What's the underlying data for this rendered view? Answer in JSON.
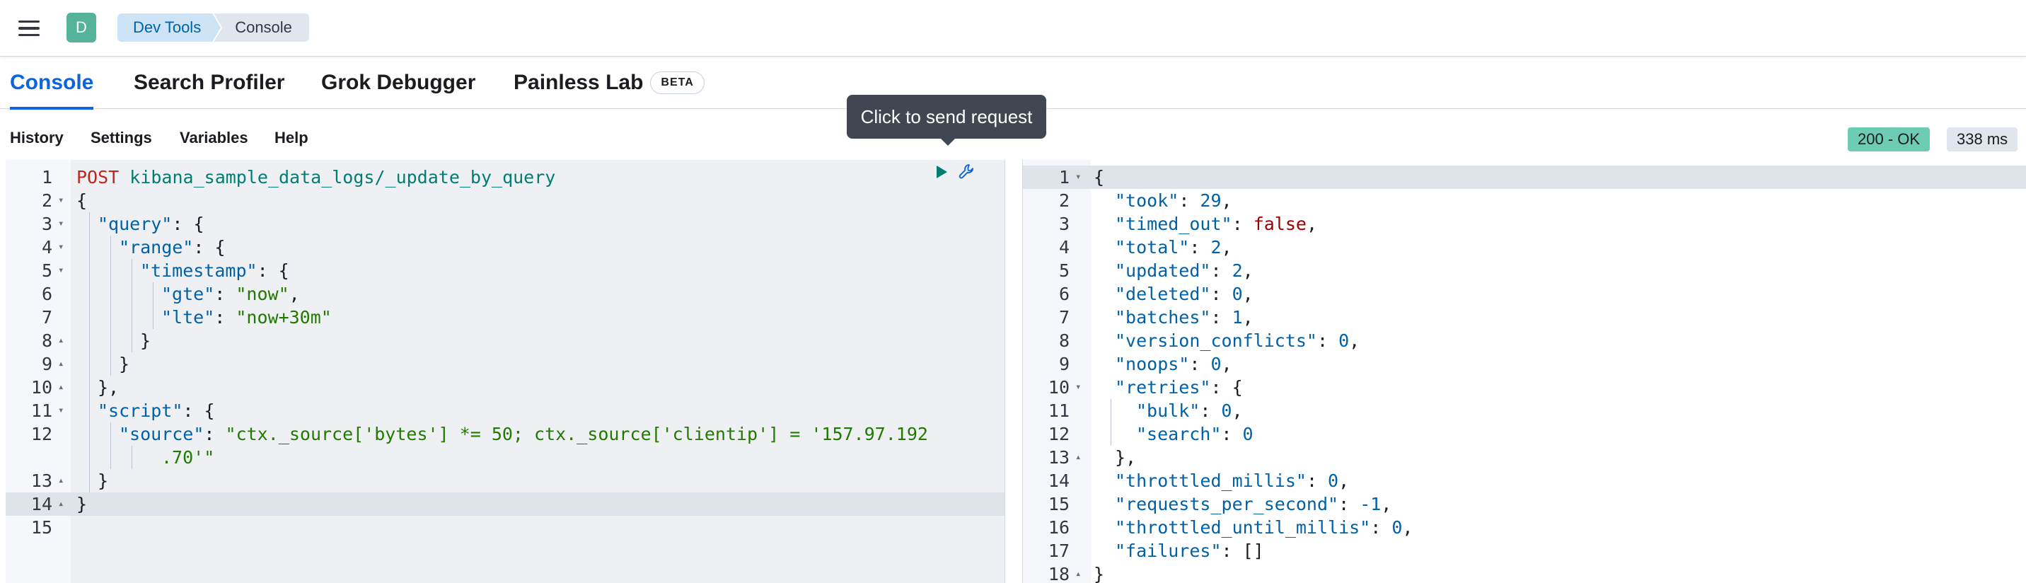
{
  "header": {
    "space_initial": "D",
    "breadcrumbs": [
      "Dev Tools",
      "Console"
    ]
  },
  "tabs": [
    {
      "label": "Console",
      "active": true
    },
    {
      "label": "Search Profiler",
      "active": false
    },
    {
      "label": "Grok Debugger",
      "active": false
    },
    {
      "label": "Painless Lab",
      "active": false,
      "badge": "BETA"
    }
  ],
  "toolbar": {
    "items": [
      "History",
      "Settings",
      "Variables",
      "Help"
    ],
    "status": "200 - OK",
    "duration": "338 ms"
  },
  "tooltip": "Click to send request",
  "request": {
    "method": "POST",
    "url": "kibana_sample_data_logs/_update_by_query",
    "lines": [
      {
        "n": "1",
        "fold": ""
      },
      {
        "n": "2",
        "fold": "▾",
        "text": "{"
      },
      {
        "n": "3",
        "fold": "▾",
        "key": "\"query\"",
        "after": ": {"
      },
      {
        "n": "4",
        "fold": "▾",
        "key": "\"range\"",
        "after": ": {"
      },
      {
        "n": "5",
        "fold": "▾",
        "key": "\"timestamp\"",
        "after": ": {"
      },
      {
        "n": "6",
        "fold": "",
        "key": "\"gte\"",
        "after": ": ",
        "str": "\"now\"",
        "tail": ","
      },
      {
        "n": "7",
        "fold": "",
        "key": "\"lte\"",
        "after": ": ",
        "str": "\"now+30m\"",
        "tail": ""
      },
      {
        "n": "8",
        "fold": "▴",
        "text": "}"
      },
      {
        "n": "9",
        "fold": "▴",
        "text": "}"
      },
      {
        "n": "10",
        "fold": "▴",
        "text": "},"
      },
      {
        "n": "11",
        "fold": "▾",
        "key": "\"script\"",
        "after": ": {"
      },
      {
        "n": "12",
        "fold": "",
        "key": "\"source\"",
        "after": ": ",
        "str": "\"ctx._source['bytes'] *= 50; ctx._source['clientip'] = '157.97.192",
        "tail": ""
      },
      {
        "n": "",
        "fold": "",
        "str": ".70'\"",
        "tail": ""
      },
      {
        "n": "13",
        "fold": "▴",
        "text": "}"
      },
      {
        "n": "14",
        "fold": "▴",
        "text": "}"
      },
      {
        "n": "15",
        "fold": "",
        "text": ""
      }
    ]
  },
  "response": {
    "lines": [
      {
        "n": "1",
        "fold": "▾",
        "text": "{"
      },
      {
        "n": "2",
        "key": "\"took\"",
        "val": "29",
        "tail": ","
      },
      {
        "n": "3",
        "key": "\"timed_out\"",
        "bool": "false",
        "tail": ","
      },
      {
        "n": "4",
        "key": "\"total\"",
        "val": "2",
        "tail": ","
      },
      {
        "n": "5",
        "key": "\"updated\"",
        "val": "2",
        "tail": ","
      },
      {
        "n": "6",
        "key": "\"deleted\"",
        "val": "0",
        "tail": ","
      },
      {
        "n": "7",
        "key": "\"batches\"",
        "val": "1",
        "tail": ","
      },
      {
        "n": "8",
        "key": "\"version_conflicts\"",
        "val": "0",
        "tail": ","
      },
      {
        "n": "9",
        "key": "\"noops\"",
        "val": "0",
        "tail": ","
      },
      {
        "n": "10",
        "fold": "▾",
        "key": "\"retries\"",
        "text": ": {"
      },
      {
        "n": "11",
        "key": "\"bulk\"",
        "val": "0",
        "tail": ","
      },
      {
        "n": "12",
        "key": "\"search\"",
        "val": "0",
        "tail": ""
      },
      {
        "n": "13",
        "fold": "▴",
        "text": "},"
      },
      {
        "n": "14",
        "key": "\"throttled_millis\"",
        "val": "0",
        "tail": ","
      },
      {
        "n": "15",
        "key": "\"requests_per_second\"",
        "val": "-1",
        "tail": ","
      },
      {
        "n": "16",
        "key": "\"throttled_until_millis\"",
        "val": "0",
        "tail": ","
      },
      {
        "n": "17",
        "key": "\"failures\"",
        "text": ": []"
      },
      {
        "n": "18",
        "fold": "▴",
        "text": "}"
      }
    ]
  },
  "colors": {
    "accent": "#0b64dd",
    "status_ok": "#6dccb1",
    "avatar": "#54b399"
  }
}
